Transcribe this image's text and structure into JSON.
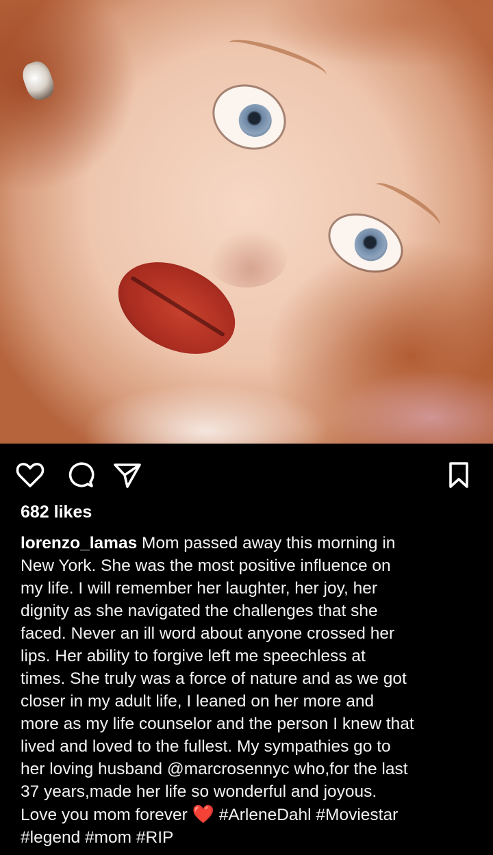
{
  "post": {
    "likes_text": "682 likes",
    "username": "lorenzo_lamas",
    "caption_lines": [
      "Mom passed away this morning in",
      "New York. She was the most positive influence on",
      "my life. I will remember her laughter, her joy, her",
      "dignity as she navigated the challenges that she",
      "faced. Never an ill word about anyone crossed her",
      "lips. Her ability to forgive left me speechless at",
      "times. She truly was a force of nature and as we got",
      "closer in my adult life, I leaned on her more and",
      "more as my life counselor and the person I knew that",
      "lived and loved to the fullest. My sympathies go to"
    ],
    "line11_pre": "her loving husband ",
    "mention": "@marcrosennyc",
    "line11_post": " who,for the last",
    "line12": "37 years,made her life so wonderful and joyous.",
    "line13_text": "Love you mom forever",
    "emoji": "❤️",
    "hashtags_line13": [
      "#ArleneDahl",
      "#Moviestar"
    ],
    "hashtags_line14": [
      "#legend",
      "#mom",
      "#RIP"
    ]
  },
  "icons": {
    "like": "heart-outline-icon",
    "comment": "comment-bubble-icon",
    "share": "paper-plane-icon",
    "save": "bookmark-icon"
  },
  "colors": {
    "background": "#000000",
    "text": "#f2f2f2",
    "heart_emoji": "#e0202e"
  }
}
